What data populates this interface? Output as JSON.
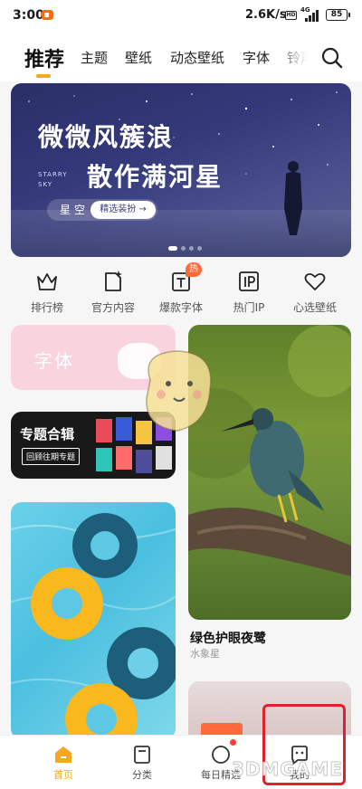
{
  "status_bar": {
    "time": "3:00",
    "network_speed": "2.6K/s",
    "hd_label": "HD",
    "network_type": "4G",
    "battery": "85"
  },
  "tabs": [
    {
      "label": "推荐",
      "active": true
    },
    {
      "label": "主题"
    },
    {
      "label": "壁纸"
    },
    {
      "label": "动态壁纸"
    },
    {
      "label": "字体"
    },
    {
      "label": "铃声"
    }
  ],
  "banner": {
    "line1": "微微风簇浪",
    "line2": "散作满河星",
    "english": "STARRY\nSKY",
    "theme_name": "星空",
    "button": "精选装扮 →",
    "page_count": 4,
    "current_page": 1
  },
  "categories": [
    {
      "label": "排行榜",
      "icon": "crown-icon"
    },
    {
      "label": "官方内容",
      "icon": "sparkle-doc-icon"
    },
    {
      "label": "爆款字体",
      "icon": "font-t-icon",
      "badge": "热"
    },
    {
      "label": "热门IP",
      "icon": "ip-icon"
    },
    {
      "label": "心选壁纸",
      "icon": "heart-icon"
    }
  ],
  "cards": {
    "font_card_label": "字体",
    "topic_title": "专题合辑",
    "topic_sub": "回顾往期专题",
    "bird_title": "绿色护眼夜鹭",
    "bird_author": "水象星"
  },
  "bottom_nav": [
    {
      "label": "首页",
      "icon": "home-icon",
      "active": true
    },
    {
      "label": "分类",
      "icon": "category-icon"
    },
    {
      "label": "每日精选",
      "icon": "daily-icon",
      "dot": true
    },
    {
      "label": "我的",
      "icon": "profile-icon"
    }
  ],
  "watermark": "3DMGAME",
  "colors": {
    "accent": "#f5a623",
    "highlight_box": "#e0202a",
    "badge": "#ff6a3d"
  }
}
